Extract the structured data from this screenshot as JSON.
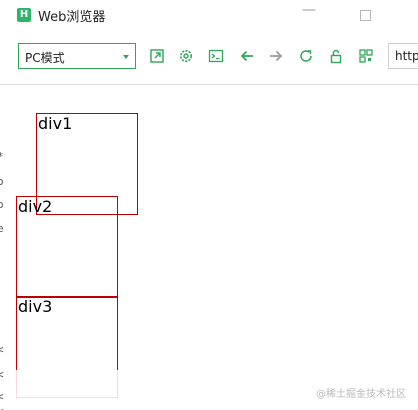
{
  "window": {
    "icon_letter": "H",
    "title": "Web浏览器"
  },
  "toolbar": {
    "mode_value": "PC模式",
    "url_value": "http"
  },
  "demo": {
    "div1_label": "div1",
    "div2_label": "div2",
    "div3_label": "div3",
    "border_color": "#c00000"
  },
  "gutter": {
    "chars": [
      "*",
      "o",
      "o",
      "e",
      "<",
      "<",
      "<",
      "<"
    ]
  },
  "watermark": {
    "text": "@稀土掘金技术社区"
  },
  "colors": {
    "accent": "#2fa65a"
  }
}
